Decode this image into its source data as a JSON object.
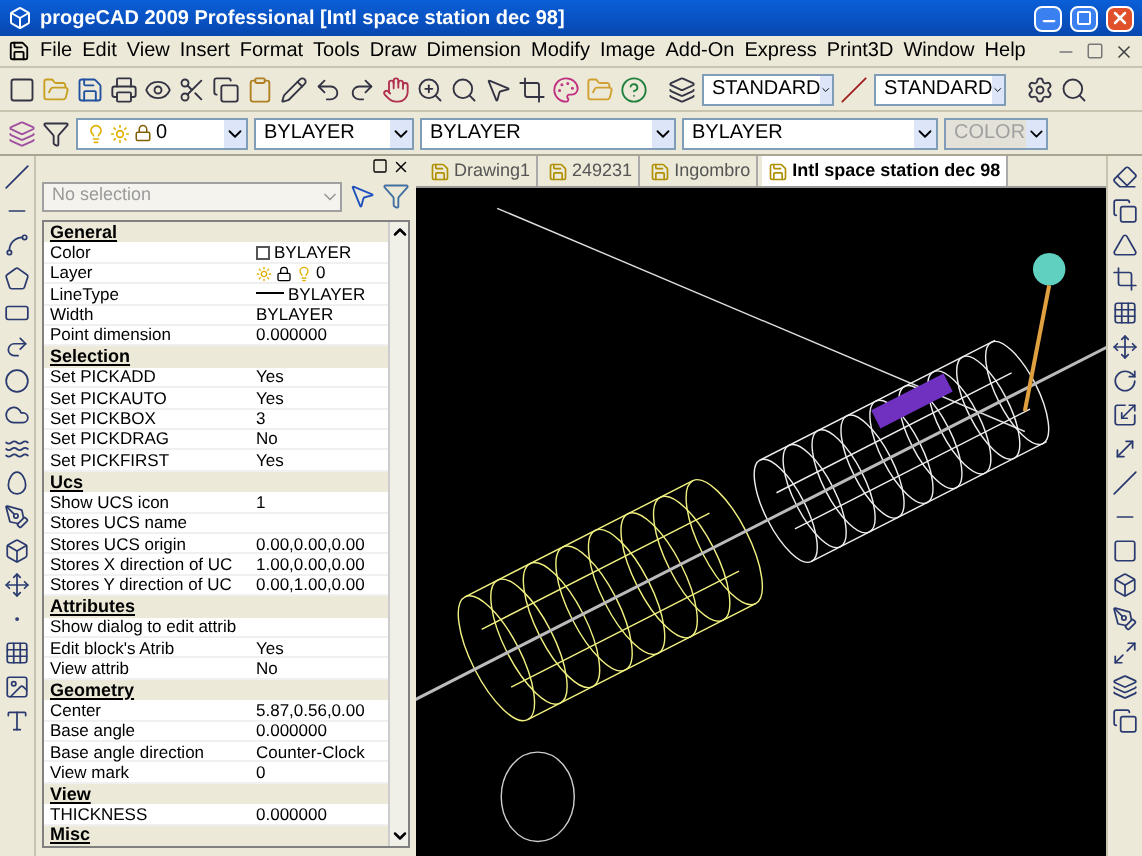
{
  "window": {
    "title": "progeCAD 2009 Professional [Intl space station dec 98]"
  },
  "menu": [
    "File",
    "Edit",
    "View",
    "Insert",
    "Format",
    "Tools",
    "Draw",
    "Dimension",
    "Modify",
    "Image",
    "Add-On",
    "Express",
    "Print3D",
    "Window",
    "Help"
  ],
  "toolbar": {
    "text_style": "STANDARD",
    "dim_style": "STANDARD"
  },
  "properties_toolbar": {
    "layer": "0",
    "entity_colour": "BYLAYER",
    "linetype": "BYLAYER",
    "lineweight": "BYLAYER",
    "plot_style": {
      "label": "COLOR",
      "disabled": true
    }
  },
  "properties": {
    "selection": "No selection",
    "sections": [
      {
        "title": "General",
        "rows": [
          {
            "kind": "color",
            "label": "Color",
            "value": "BYLAYER"
          },
          {
            "kind": "layer",
            "label": "Layer",
            "value": "0"
          },
          {
            "kind": "linetype",
            "label": "LineType",
            "value": "BYLAYER"
          },
          {
            "kind": "text",
            "label": "Width",
            "value": "BYLAYER"
          },
          {
            "kind": "text",
            "label": "Point dimension",
            "value": "0.000000"
          }
        ]
      },
      {
        "title": "Selection",
        "rows": [
          {
            "kind": "text",
            "label": "Set PICKADD",
            "value": "Yes"
          },
          {
            "kind": "text",
            "label": "Set PICKAUTO",
            "value": "Yes"
          },
          {
            "kind": "text",
            "label": "Set PICKBOX",
            "value": "3"
          },
          {
            "kind": "text",
            "label": "Set PICKDRAG",
            "value": "No"
          },
          {
            "kind": "text",
            "label": "Set PICKFIRST",
            "value": "Yes"
          }
        ]
      },
      {
        "title": "Ucs",
        "rows": [
          {
            "kind": "text",
            "label": "Show UCS icon",
            "value": "1"
          },
          {
            "kind": "text",
            "label": "Stores UCS name"
          },
          {
            "kind": "text",
            "label": "Stores UCS origin",
            "value": "0.00,0.00,0.00"
          },
          {
            "kind": "text",
            "label": "Stores X direction of UC",
            "value": "1.00,0.00,0.00"
          },
          {
            "kind": "text",
            "label": "Stores Y direction of UC",
            "value": "0.00,1.00,0.00"
          }
        ]
      },
      {
        "title": "Attributes",
        "rows": [
          {
            "kind": "text",
            "label": "Show dialog to edit attrib"
          },
          {
            "kind": "text",
            "label": "Edit block's Atrib",
            "value": "Yes"
          },
          {
            "kind": "text",
            "label": "View attrib",
            "value": "No"
          }
        ]
      },
      {
        "title": "Geometry",
        "rows": [
          {
            "kind": "text",
            "label": "Center",
            "value": "5.87,0.56,0.00"
          },
          {
            "kind": "text",
            "label": "Base angle",
            "value": "0.000000"
          },
          {
            "kind": "text",
            "label": "Base angle direction",
            "value": "Counter-Clock"
          },
          {
            "kind": "text",
            "label": "View mark",
            "value": "0"
          }
        ]
      },
      {
        "title": "View",
        "rows": [
          {
            "kind": "text",
            "label": "THICKNESS",
            "value": "0.000000"
          }
        ]
      },
      {
        "title": "Misc"
      }
    ]
  },
  "tabs": [
    {
      "label": "Drawing1",
      "selected": false
    },
    {
      "label": "249231",
      "selected": false
    },
    {
      "label": "Ingombro",
      "selected": false
    },
    {
      "label": "Intl space station dec 98",
      "selected": true
    }
  ]
}
